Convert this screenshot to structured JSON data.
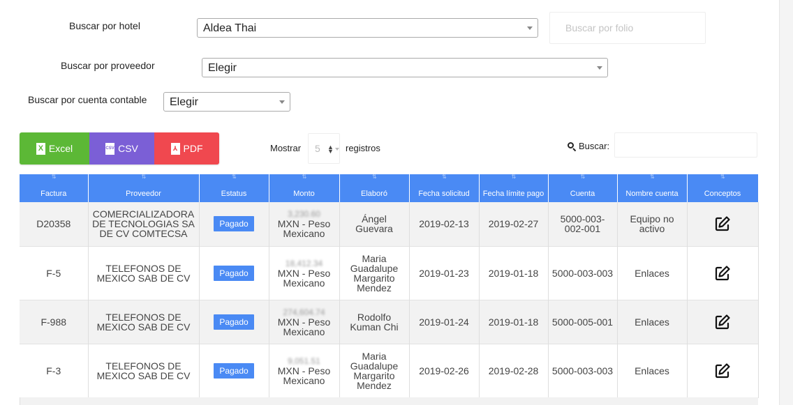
{
  "filters": {
    "hotel_label": "Buscar por hotel",
    "hotel_value": "Aldea Thai",
    "folio_placeholder": "Buscar por folio",
    "proveedor_label": "Buscar por proveedor",
    "proveedor_value": "Elegir",
    "cuenta_label": "Buscar por cuenta contable",
    "cuenta_value": "Elegir"
  },
  "export_buttons": {
    "excel": "Excel",
    "csv": "CSV",
    "pdf": "PDF",
    "excel_icon_glyph": "X",
    "csv_icon_glyph": "CSV",
    "pdf_icon_glyph": "⅄"
  },
  "length_control": {
    "mostrar_label": "Mostrar",
    "value": "5",
    "registros_label": "registros"
  },
  "search": {
    "label": "Buscar:",
    "value": ""
  },
  "colors": {
    "header_blue": "#4a8af4",
    "excel_green": "#5cb836",
    "csv_purple": "#7b5fd6",
    "pdf_red": "#f0484f"
  },
  "table": {
    "columns": [
      "Factura",
      "Proveedor",
      "Estatus",
      "Monto",
      "Elaboró",
      "Fecha solicitud",
      "Fecha límite pago",
      "Cuenta",
      "Nombre cuenta",
      "Conceptos"
    ],
    "rows": [
      {
        "factura": "D20358",
        "proveedor": "COMERCIALIZADORA DE TECNOLOGIAS SA DE CV COMTECSA",
        "estatus": "Pagado",
        "monto_amount": "3,230.60",
        "monto_currency": "MXN - Peso Mexicano",
        "elaboro": "Ángel Guevara",
        "fecha_solicitud": "2019-02-13",
        "fecha_limite": "2019-02-27",
        "cuenta": "5000-003-002-001",
        "nombre_cuenta": "Equipo no activo",
        "conceptos_icon": "edit-icon"
      },
      {
        "factura": "F-5",
        "proveedor": "TELEFONOS DE MEXICO SAB DE CV",
        "estatus": "Pagado",
        "monto_amount": "18,412.34",
        "monto_currency": "MXN - Peso Mexicano",
        "elaboro": "Maria Guadalupe Margarito Mendez",
        "fecha_solicitud": "2019-01-23",
        "fecha_limite": "2019-01-18",
        "cuenta": "5000-003-003",
        "nombre_cuenta": "Enlaces",
        "conceptos_icon": "edit-icon"
      },
      {
        "factura": "F-988",
        "proveedor": "TELEFONOS DE MEXICO SAB DE CV",
        "estatus": "Pagado",
        "monto_amount": "274,604.74",
        "monto_currency": "MXN - Peso Mexicano",
        "elaboro": "Rodolfo Kuman Chi",
        "fecha_solicitud": "2019-01-24",
        "fecha_limite": "2019-01-18",
        "cuenta": "5000-005-001",
        "nombre_cuenta": "Enlaces",
        "conceptos_icon": "edit-icon"
      },
      {
        "factura": "F-3",
        "proveedor": "TELEFONOS DE MEXICO SAB DE CV",
        "estatus": "Pagado",
        "monto_amount": "9,051.51",
        "monto_currency": "MXN - Peso Mexicano",
        "elaboro": "Maria Guadalupe Margarito Mendez",
        "fecha_solicitud": "2019-02-26",
        "fecha_limite": "2019-02-28",
        "cuenta": "5000-003-003",
        "nombre_cuenta": "Enlaces",
        "conceptos_icon": "edit-icon"
      }
    ]
  }
}
